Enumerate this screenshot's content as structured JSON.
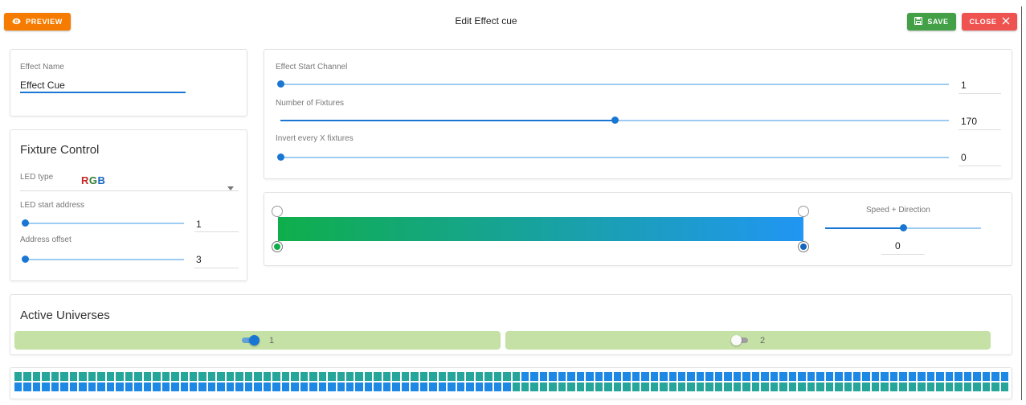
{
  "header": {
    "title": "Edit Effect cue",
    "preview_label": "PREVIEW",
    "save_label": "SAVE",
    "close_label": "CLOSE"
  },
  "effect_name": {
    "label": "Effect Name",
    "value": "Effect Cue"
  },
  "fixture_control": {
    "title": "Fixture Control",
    "led_type_label": "LED type",
    "led_type_value": [
      "R",
      "G",
      "B"
    ],
    "led_type_colors": [
      "#c62828",
      "#2e7d32",
      "#1565c0"
    ],
    "led_start_label": "LED start address",
    "led_start_value": "1",
    "address_offset_label": "Address offset",
    "address_offset_value": "3"
  },
  "channels": {
    "start_channel_label": "Effect Start Channel",
    "start_channel_value": "1",
    "fixtures_label": "Number of Fixtures",
    "fixtures_value": "170",
    "fixtures_fraction": 0.5,
    "invert_label": "Invert every X fixtures",
    "invert_value": "0"
  },
  "gradient": {
    "start_color": "#0fae4b",
    "end_color": "#2196f3",
    "speed_label": "Speed + Direction",
    "speed_value": "0"
  },
  "universes": {
    "title": "Active Universes",
    "items": [
      {
        "number": "1",
        "enabled": true
      },
      {
        "number": "2",
        "enabled": false
      }
    ]
  },
  "colors": {
    "preview": "#f57c00",
    "save": "#43a047",
    "close": "#ef5350",
    "slider": "#1976d2",
    "universe_bar": "#c5e1a5",
    "cell_teal": "#26a69a",
    "cell_blue": "#1e88e5"
  }
}
